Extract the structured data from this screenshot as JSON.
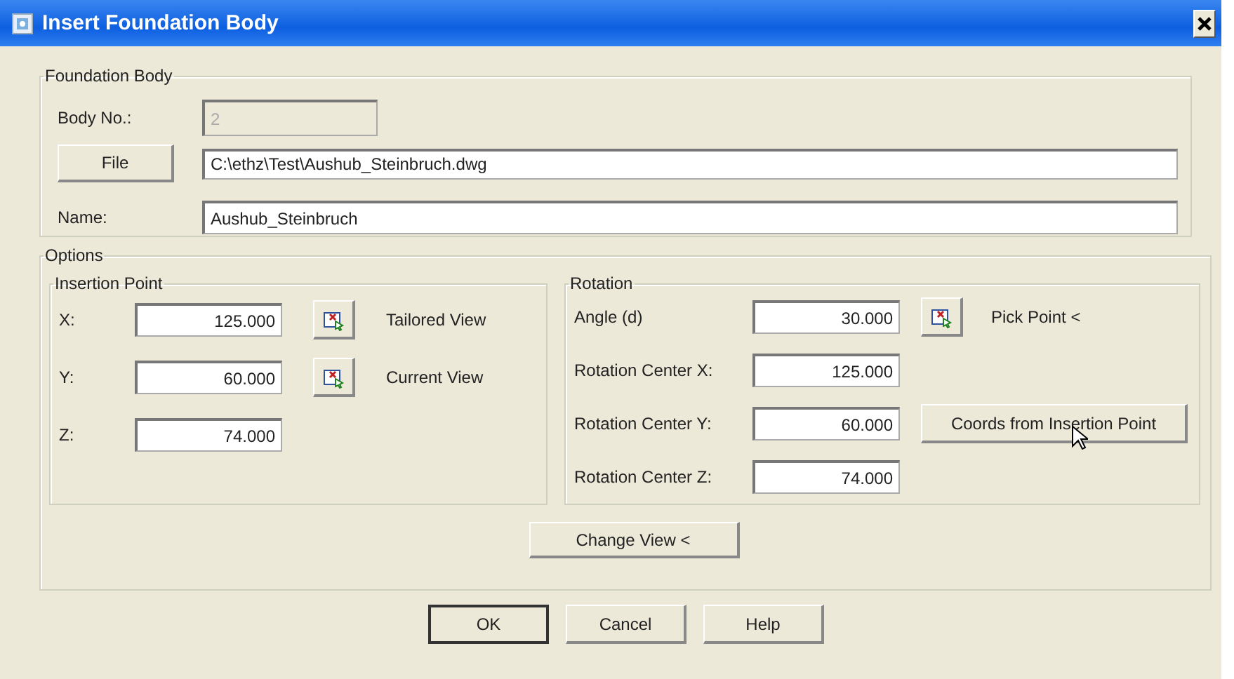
{
  "window": {
    "title": "Insert Foundation Body"
  },
  "foundation_body": {
    "title": "Foundation Body",
    "body_no": {
      "label": "Body No.:",
      "value": "2",
      "disabled": true
    },
    "file_button": "File",
    "file_path": "C:\\ethz\\Test\\Aushub_Steinbruch.dwg",
    "name": {
      "label": "Name:",
      "value": "Aushub_Steinbruch"
    }
  },
  "options": {
    "title": "Options",
    "insertion_point": {
      "title": "Insertion Point",
      "rows": [
        {
          "label": "X:",
          "value": "125.000",
          "action": "Tailored View"
        },
        {
          "label": "Y:",
          "value": "60.000",
          "action": "Current View"
        },
        {
          "label": "Z:",
          "value": "74.000"
        }
      ]
    },
    "rotation": {
      "title": "Rotation",
      "rows": [
        {
          "label": "Angle (d)",
          "value": "30.000"
        },
        {
          "label": "Rotation Center X:",
          "value": "125.000"
        },
        {
          "label": "Rotation Center Y:",
          "value": "60.000"
        },
        {
          "label": "Rotation Center Z:",
          "value": "74.000"
        }
      ],
      "pick_point": "Pick Point <",
      "coords_button": "Coords from Insertion Point"
    },
    "change_view_button": "Change View <"
  },
  "buttons": [
    "OK",
    "Cancel",
    "Help"
  ]
}
